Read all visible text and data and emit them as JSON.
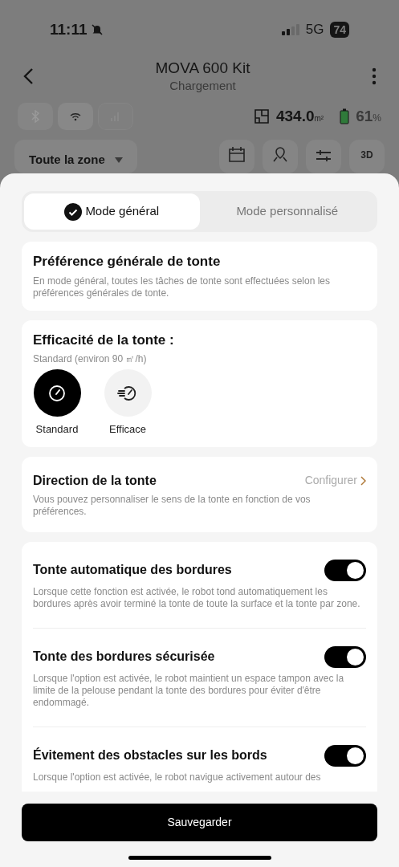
{
  "status_bar": {
    "time": "11:11",
    "network": "5G",
    "battery": "74"
  },
  "header": {
    "title": "MOVA 600 Kit",
    "subtitle": "Chargement"
  },
  "stats": {
    "area_value": "434.0",
    "area_unit": "m²",
    "battery_value": "61",
    "battery_unit": "%"
  },
  "zone_dropdown": {
    "label": "Toute la zone"
  },
  "view_button": {
    "label": "3D"
  },
  "tabs": [
    {
      "label": "Mode général",
      "selected": true
    },
    {
      "label": "Mode personnalisé",
      "selected": false
    }
  ],
  "general_preference": {
    "title": "Préférence générale de tonte",
    "description": "En mode général, toutes les tâches de tonte sont effectuées selon les préférences générales de tonte."
  },
  "efficiency": {
    "title": "Efficacité de la tonte :",
    "subtitle": "Standard (environ 90 ㎡/h)",
    "options": [
      {
        "label": "Standard",
        "selected": true,
        "kind": "gauge"
      },
      {
        "label": "Efficace",
        "selected": false,
        "kind": "fast"
      }
    ]
  },
  "direction": {
    "title": "Direction de la tonte",
    "action": "Configurer",
    "description": "Vous pouvez personnaliser le sens de la tonte en fonction de vos préférences."
  },
  "toggles": [
    {
      "title": "Tonte automatique des bordures",
      "on": true,
      "description": "Lorsque cette fonction est activée, le robot tond automatiquement les bordures après avoir terminé la tonte de toute la surface et la tonte par zone."
    },
    {
      "title": "Tonte des bordures sécurisée",
      "on": true,
      "description": "Lorsque l'option est activée, le robot maintient un espace tampon avec la limite de la pelouse pendant la tonte des bordures pour éviter d'être endommagé."
    },
    {
      "title": "Évitement des obstacles sur les bords",
      "on": true,
      "description": "Lorsque l'option est activée, le robot navigue activement autour des"
    }
  ],
  "save_button": {
    "label": "Sauvegarder"
  }
}
